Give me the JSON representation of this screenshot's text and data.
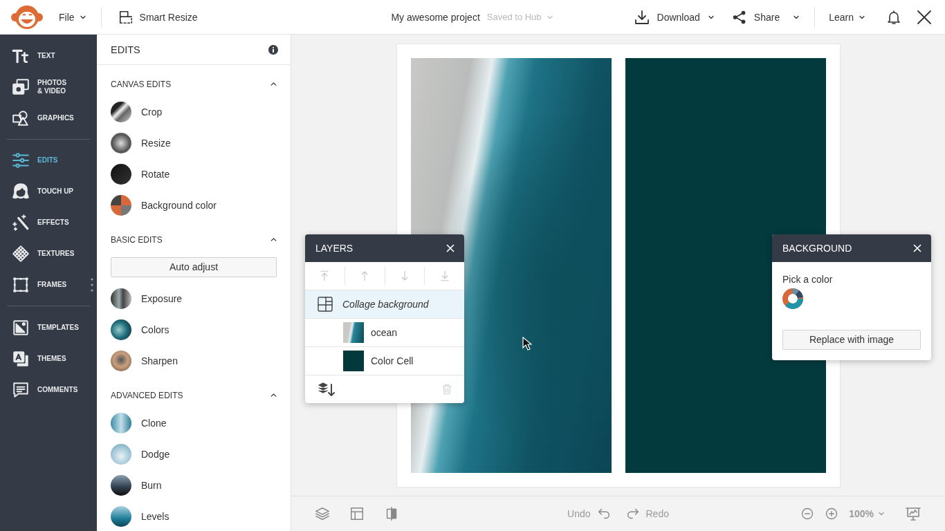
{
  "topbar": {
    "file_menu": "File",
    "smart_resize": "Smart Resize",
    "project_title": "My awesome project",
    "save_status": "Saved to Hub",
    "download": "Download",
    "share": "Share",
    "learn": "Learn"
  },
  "nav": [
    {
      "items": [
        {
          "kind": "text",
          "label": "TEXT",
          "selected": false
        },
        {
          "kind": "photos",
          "label": "PHOTOS\n& VIDEO",
          "selected": false
        },
        {
          "kind": "graphics",
          "label": "GRAPHICS",
          "selected": false
        }
      ]
    },
    {
      "items": [
        {
          "kind": "edits",
          "label": "EDITS",
          "selected": true
        },
        {
          "kind": "touchup",
          "label": "TOUCH UP",
          "selected": false
        },
        {
          "kind": "effects",
          "label": "EFFECTS",
          "selected": false
        },
        {
          "kind": "textures",
          "label": "TEXTURES",
          "selected": false
        },
        {
          "kind": "frames",
          "label": "FRAMES",
          "selected": false
        }
      ]
    },
    {
      "items": [
        {
          "kind": "templates",
          "label": "TEMPLATES",
          "selected": false
        },
        {
          "kind": "themes",
          "label": "THEMES",
          "selected": false
        },
        {
          "kind": "comments",
          "label": "COMMENTS",
          "selected": false
        }
      ]
    }
  ],
  "edits_panel": {
    "title": "EDITS",
    "sections": [
      {
        "title": "CANVAS EDITS",
        "expanded": true,
        "items": [
          {
            "kind": "tool",
            "label": "Crop"
          },
          {
            "kind": "tool",
            "label": "Resize"
          },
          {
            "kind": "tool",
            "label": "Rotate"
          },
          {
            "kind": "tool",
            "label": "Background color"
          }
        ]
      },
      {
        "title": "BASIC EDITS",
        "expanded": true,
        "items": [
          {
            "kind": "button",
            "label": "Auto adjust"
          },
          {
            "kind": "tool",
            "label": "Exposure"
          },
          {
            "kind": "tool",
            "label": "Colors"
          },
          {
            "kind": "tool",
            "label": "Sharpen"
          }
        ]
      },
      {
        "title": "ADVANCED EDITS",
        "expanded": true,
        "items": [
          {
            "kind": "tool",
            "label": "Clone"
          },
          {
            "kind": "tool",
            "label": "Dodge"
          },
          {
            "kind": "tool",
            "label": "Burn"
          },
          {
            "kind": "tool",
            "label": "Levels"
          }
        ]
      }
    ]
  },
  "canvas": {
    "cells": [
      {
        "kind": "photo"
      },
      {
        "kind": "color"
      }
    ]
  },
  "layers_panel": {
    "title": "LAYERS",
    "tools": [
      {
        "kind": "to-top",
        "disabled": true
      },
      {
        "kind": "up",
        "disabled": true
      },
      {
        "kind": "down",
        "disabled": true
      },
      {
        "kind": "to-bottom",
        "disabled": true
      }
    ],
    "layers": [
      {
        "kind": "group",
        "label": "Collage background",
        "selected": true,
        "children": [
          {
            "kind": "image",
            "label": "ocean",
            "selected": false
          },
          {
            "kind": "color",
            "label": "Color Cell",
            "selected": false
          }
        ]
      }
    ],
    "delete_disabled": true
  },
  "background_panel": {
    "title": "BACKGROUND",
    "pick_label": "Pick a color",
    "replace_button": "Replace with image"
  },
  "bottom_bar": {
    "undo": "Undo",
    "redo": "Redo",
    "zoom": "100%"
  }
}
